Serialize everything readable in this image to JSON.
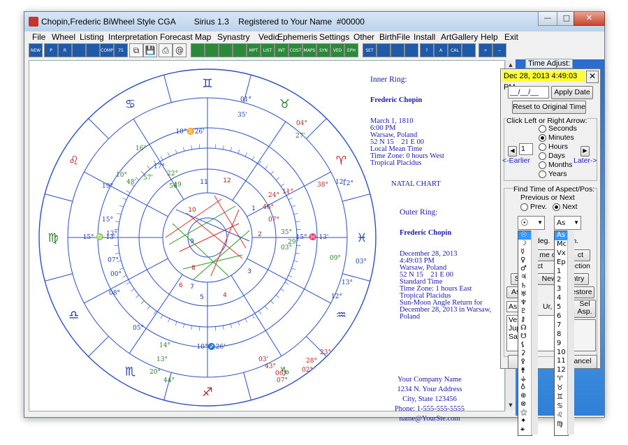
{
  "window": {
    "title": "Chopin,Frederic BiWheel Style CGA",
    "app": "Sirius 1.3",
    "registration": "Registered to Your Name  #00000",
    "minimize": "—",
    "maximize": "□",
    "close": "✕"
  },
  "menu": [
    "File",
    "Wheel",
    "Listing",
    "Interpretation",
    "Forecast",
    "Map",
    "Synastry",
    "Vedic",
    "Ephemeris",
    "Settings",
    "Other",
    "BirthFile",
    "Install",
    "ArtGallery",
    "Help",
    "Exit"
  ],
  "toolbar": [
    {
      "icon": "new-icon",
      "label": "NEW"
    },
    {
      "icon": "print-chart-icon",
      "label": "P"
    },
    {
      "icon": "report-icon",
      "label": "R"
    },
    {
      "icon": "comet-icon",
      "label": ""
    },
    {
      "icon": "nova-icon",
      "label": ""
    },
    {
      "icon": "compare-icon",
      "label": "COMP"
    },
    {
      "icon": "wheel-number-icon",
      "label": "75"
    },
    {
      "icon": "copy-icon",
      "label": "⧉"
    },
    {
      "icon": "save-icon",
      "label": "💾"
    },
    {
      "icon": "printer-icon",
      "label": "⎙"
    },
    {
      "icon": "email-icon",
      "label": "@"
    },
    {
      "icon": "wheel-icon",
      "label": ""
    },
    {
      "icon": "wheel2-icon",
      "label": ""
    },
    {
      "icon": "grid-icon",
      "label": ""
    },
    {
      "icon": "planet-icon",
      "label": ""
    },
    {
      "icon": "mpt-icon",
      "label": "MPT"
    },
    {
      "icon": "list-icon",
      "label": "LIST"
    },
    {
      "icon": "int-icon",
      "label": "INT"
    },
    {
      "icon": "cost-icon",
      "label": "COST"
    },
    {
      "icon": "maps-icon",
      "label": "MAPS"
    },
    {
      "icon": "syn-icon",
      "label": "SYN"
    },
    {
      "icon": "ved-icon",
      "label": "VED"
    },
    {
      "icon": "eph-icon",
      "label": "EPH"
    },
    {
      "icon": "settings-icon",
      "label": "SET"
    },
    {
      "icon": "clock-icon",
      "label": ""
    },
    {
      "icon": "chart-gen-icon",
      "label": ""
    },
    {
      "icon": "quick-icon",
      "label": ""
    },
    {
      "icon": "help-icon",
      "label": "?"
    },
    {
      "icon": "text-icon",
      "label": "A"
    },
    {
      "icon": "cal-icon",
      "label": "CAL"
    },
    {
      "icon": "hand-icon",
      "label": ""
    },
    {
      "icon": "zoom-in-icon",
      "label": "+"
    },
    {
      "icon": "zoom-out-icon",
      "label": "−"
    }
  ],
  "inner_ring": {
    "heading": "Inner Ring:",
    "name": "Frederic Chopin",
    "lines": [
      "March 1, 1810",
      "6:00 PM",
      "Warsaw, Poland",
      "52 N 15    21 E 00",
      "Local Mean Time",
      "Time Zone: 0 hours West",
      "Tropical Placidus"
    ],
    "chart_type": "NATAL CHART"
  },
  "outer_ring": {
    "heading": "Outer Ring:",
    "name": "Frederic Chopin",
    "lines": [
      "December 28, 2013",
      "4:49:03 PM",
      "Warsaw, Poland",
      "52 N 15    21 E 00",
      "Standard Time",
      "Time Zone: 1 hours East",
      "Tropical Placidus",
      "Sun-Moon Angle Return for",
      "December 28, 2013 in Warsaw,",
      "Poland"
    ]
  },
  "company": [
    "Your Company Name",
    "1234 N. Your Address",
    "City, State 123456",
    "Phone: 1-555-555-5555",
    "name@YourSte.com"
  ],
  "wheel": {
    "house_numbers": [
      "1",
      "2",
      "3",
      "4",
      "5",
      "6",
      "7",
      "8",
      "9",
      "10",
      "11",
      "12"
    ],
    "cusp_labels": {
      "mc": "10°♊26'",
      "ic": "10°♐26'",
      "asc": "15° ♍ 13'",
      "dsc": "15° ♓ 13'"
    },
    "outer_degrees": [
      "01°",
      "35'",
      "04°",
      "27'",
      "38°",
      "12°",
      "12°",
      "09°",
      "03°",
      "13°",
      "12°",
      "23°",
      "28°",
      "02°",
      "10°",
      "48'",
      "19°",
      "15°",
      "13°",
      "07°",
      "00°",
      "08°",
      "05°",
      "57'",
      "17°",
      "22°",
      "49",
      "14°",
      "13°",
      "20°",
      "44°",
      "03'",
      "43°",
      "06°",
      "07°",
      "11°",
      "24°",
      "46°",
      "07°",
      "35°",
      "29°",
      "03°",
      "16°",
      "56"
    ]
  },
  "time_adjust": {
    "tab": "Time Adjust:",
    "datetime": "Dec 28, 2013   4:49:03 PM",
    "close": "✕",
    "date_input": "__/__/__",
    "apply_date": "Apply Date",
    "reset": "Reset to Original Time",
    "arrow_hint": "Click Left or Right Arrow:",
    "units": [
      "Seconds",
      "Minutes",
      "Hours",
      "Days",
      "Months",
      "Years"
    ],
    "selected_unit": "Minutes",
    "step": "1",
    "earlier": "<-Earlier",
    "later": "Later->",
    "find_label": "Find Time of Aspect/Pos:",
    "prev_next_label": "Previous or Next",
    "prev": "Prev.",
    "next": "Next",
    "planet_a": "☉",
    "planet_b": "As",
    "deg_label": "deg.",
    "min_label": "in.",
    "partial_buttons": [
      "me o",
      "ct",
      "ect",
      "ection",
      "Sa",
      "New",
      "Country",
      "Asp",
      "estore",
      "Sel",
      "Asp."
    ],
    "list_items": [
      "Ven",
      "Jup",
      "Sat"
    ],
    "list_ur": "Ur,",
    "ok": "✔",
    "cancel": "ancel"
  },
  "dropdown_planets": [
    "☉",
    "☽",
    "☿",
    "♀",
    "♂",
    "♃",
    "♄",
    "♅",
    "♆",
    "♇",
    "⚷",
    "☊",
    "☋",
    "⚸",
    "⚳",
    "⚴",
    "⚵",
    "⚶",
    "♁",
    "⊕",
    "⊗",
    "⚝",
    "✦",
    "⚹"
  ],
  "dropdown_positions": [
    "As",
    "Mc",
    "Vx",
    "Ep",
    "1",
    "2",
    "3",
    "4",
    "5",
    "6",
    "7",
    "8",
    "9",
    "10",
    "11",
    "12",
    "♈",
    "♉",
    "♊",
    "♋",
    "♌",
    "♍"
  ],
  "dropdown_selected": {
    "left": "☉",
    "right": "As"
  }
}
